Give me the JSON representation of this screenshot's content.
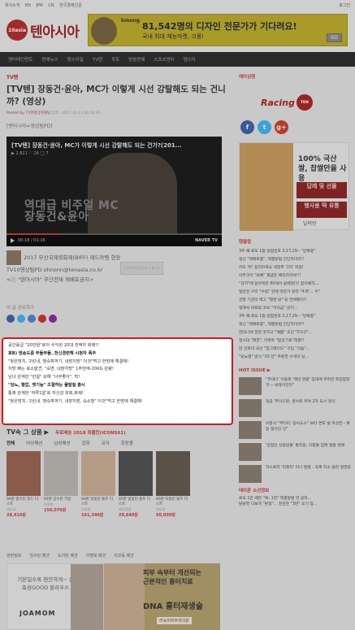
{
  "topbar": {
    "links": [
      "회사소개",
      "EN",
      "JPN",
      "CN",
      "한국경제신문"
    ],
    "right": "로그인"
  },
  "logo": {
    "circle": "10asia",
    "name": "텐아시아"
  },
  "ad_top": {
    "brand": "kmong",
    "line1": "81,542명의 디자인 전문가가 기다려요!",
    "line2": "국내 최대 재능마켓, 크몽!",
    "go": "GO"
  },
  "nav": [
    "엔터테인먼트",
    "연예뉴스",
    "텐스타일",
    "TV텐",
    "포토",
    "방송연예",
    "스포츠엔터",
    "텐스타"
  ],
  "article": {
    "section": "TV텐",
    "title": "[TV텐] 장동건·윤아, MC가 이렇게 시선 강탈해도 되는 건니까? (영상)",
    "meta_by": "Posted by TV텐영상취재팀",
    "meta_date": "입력 : 2017.10.13 04:10:05",
    "credit": "[텐아시아=영상팀PD]",
    "video": {
      "title": "[TV텐] 장동건·윤아, MC가 이렇게 시선 강탈해도 되는 건가?(201...",
      "meta": "▶ 2,821  ♡ 26  ◯ 7",
      "caption_line1": "역대급 비주얼 MC",
      "caption_line2": "장동건&윤아",
      "time": "00:18",
      "duration": "01:16",
      "brand": "NAVER TV",
      "progress": 0.24
    },
    "after_line1": "2017 부산국제영화제(BIFF) 레드카펫 현장",
    "after_ad": "신세한번장텐세대 소통러브",
    "after_line2": "TV10영상팀PD ohnonn@tenasia.co.kr",
    "after_line3": "<ⓒ \"텐아시아\" 무단전재 재배포금지>",
    "share_label": "이 글 공유하기",
    "share_colors": [
      "#3b5998",
      "#3ba1d9",
      "#4a77b5",
      "#c02a2a",
      "#7a2a8a"
    ]
  },
  "news_box": [
    {
      "text": "공인률급 \"20만원\"로아 수익된 20대 전액자 화제!!",
      "bold": false
    },
    {
      "text": "효B) 방송도중 부들부들..천신경련해 시청자 폭주",
      "bold": true
    },
    {
      "text": "\"찾은방치, 구린내, 뱃속찌꺼기, 내장지방\" 이것\"먹고 한방에 해결해!",
      "bold": false
    },
    {
      "text": "지방 빠는 효소발견, \"숙변, 내장지방\" 1주만에-20KG 감량!",
      "bold": false
    },
    {
      "text": "남녀 관계한 \"한알\" 모예 \"너무좋아\", 헉!",
      "bold": false
    },
    {
      "text": "\"당뇨, 혈압, 뱃기능\" 조절하는 물발질 출시",
      "bold": true
    },
    {
      "text": "통쾌 관계한 '하루1알'로 자신감 회복,화제!",
      "bold": false
    },
    {
      "text": "\"찾은방치, 구린내, 뱃속찌꺼기, 내장지방, 숙소형\" 이것\"먹고 한방에 해결해!",
      "bold": false
    }
  ],
  "tv_section": {
    "title": "TV속 그 상품 ▶",
    "sub": "무료배송 2018 화플칸(ICONS61)",
    "tabs": [
      "전체",
      "여성패션",
      "남성패션",
      "잡화",
      "유아",
      "화장품"
    ],
    "products": [
      {
        "name": "94판 깔끄린 후드 더스트",
        "store": "대도라",
        "price": "28,410원",
        "color": "#8a5a4a"
      },
      {
        "name": "91판 임수탄 가방",
        "store": "라보면",
        "price": "156,070원",
        "color": "#a7a39f"
      },
      {
        "name": "60판 달빛린 롱프 더스트",
        "store": "사용원",
        "price": "161,340원",
        "color": "#b39b86"
      },
      {
        "name": "85판 빛빛린 롱프 더스트",
        "store": "파트장면",
        "price": "29,640원",
        "color": "#4a4a4a"
      },
      {
        "name": "85판 이름린 롱프 더스트",
        "store": "대도라",
        "price": "50,030원",
        "color": "#5a5248"
      }
    ]
  },
  "bottom_tabs": [
    "관련정보",
    "임수탄 패션",
    "도가탄 패션",
    "이명복 패션",
    "이코등 패션"
  ],
  "ad_joamom": {
    "text": "기본일수록 편안하게~ 신축성GOOD 블라우스",
    "brand": "JOAMOM"
  },
  "ad_dna": {
    "t1a": "피부 속부터 개선되는",
    "t1b": "근본적인 흉터치료",
    "t2": "DNA 흉터재생술",
    "t3": "리뉴미피부과의원"
  },
  "side": {
    "head": "레이싱텐",
    "racing": "Racing",
    "ten": "TEN",
    "social": [
      {
        "label": "f",
        "color": "#3b5998"
      },
      {
        "label": "t",
        "color": "#3ba1d9"
      },
      {
        "label": "g+",
        "color": "#b83a2a"
      }
    ],
    "ad": {
      "t1": "100% 국산 쌀, 찹쌀만을 사용",
      "btn1": "답례 및 선물",
      "btn2": "행사용 떡 유통",
      "logo": "달떡방"
    },
    "list_head": "텐클립",
    "list": [
      "3주 째 로또 1등 당첨번호 3,17,29-- \"반복증\"",
      "정신 \"레베트증\", 해결방법 간단하더라!!",
      "카드 '빗' 갚지마세요 새정부 '1억' 지원!",
      "아무것이 \"퇴배\" 월급은 매자치카야!!!",
      "\"김치\"에 담아먹은 60에서 쉽베었다! 참아록하...",
      "일반전 구리 \"수빔\" 밑에 맛한가 당하 \"4개\"... 수\"",
      "관할 기관의 벽고 \"쟁변 당\" 당 전체메이!!",
      "정해서 바로빛 코브 \"이지금\" 원치...",
      "3주 째 로또 1등 당첨번호 3,17,29-- \"반복증\"",
      "정신 \"레베트증\", 해결방법 간단하더라!!",
      "한대니에 현양 맛하고 \"예쁨\" 조건 \"5가구\"...",
      "현시대 \"매한\", 아파트 \"탐짓기로\"해결!!",
      "만 진화의 국산 \"업그레이드\" 구입 \"석음\"...",
      "\"당뇨병\" 방식 \"20 만\" 주문한 수개의 당..."
    ],
    "hot_head": "HOT ISSUE ▶",
    "hot": [
      "\"무대다' 이동희 '백년 영광' 장대에 우라칸 회원참창 '0 -- 씨레이진터\"",
      "정공 '부사드본, 콘서트 우여 2차 도시 정식'",
      "비등석 \"부더티, 망씨도스\" 브타 연희 빛 여성은 - 복합 일어진 건\"",
      "'장점민 상담당들' 황지윤, 닥종돌 힙제 얼들 영예",
      "하스토리 '티켓티' 티니 발병 - 국제 피소 용연 정영원"
    ],
    "bottom_head": "데이온 소선정보",
    "bottom_list": [
      "로또 1만 배은 \"복- 1천\" 해결방법 연 공하...",
      "담당할 다보자 \"판정\"... 현관은 \"3만\" 쏘기 업..."
    ]
  }
}
